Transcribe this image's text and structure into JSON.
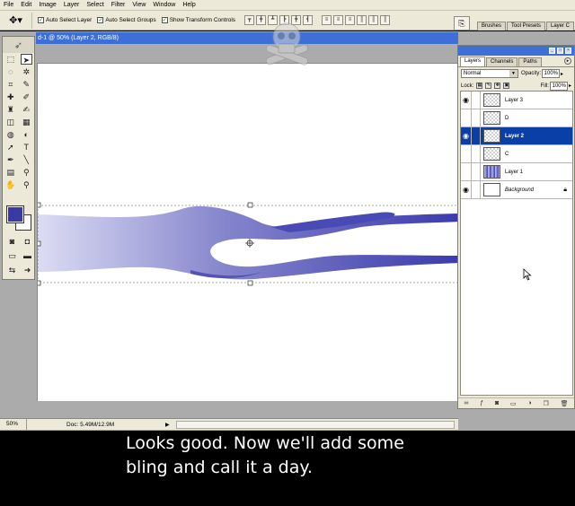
{
  "menu": [
    "File",
    "Edit",
    "Image",
    "Layer",
    "Select",
    "Filter",
    "View",
    "Window",
    "Help"
  ],
  "options": {
    "auto_select_layer": "Auto Select Layer",
    "auto_select_groups": "Auto Select Groups",
    "show_transform_controls": "Show Transform Controls"
  },
  "dock_tabs": [
    "Brushes",
    "Tool Presets",
    "Layer C"
  ],
  "document": {
    "title": "d-1 @ 50% (Layer 2, RGB/8)",
    "zoom": "50%",
    "doc_size": "Doc: 5.49M/12.9M"
  },
  "layers_panel": {
    "tabs": [
      "Layers",
      "Channels",
      "Paths"
    ],
    "blend_mode": "Normal",
    "opacity_label": "Opacity:",
    "opacity": "100%",
    "lock_label": "Lock:",
    "fill_label": "Fill:",
    "fill": "100%",
    "layers": [
      {
        "name": "Layer 3",
        "visible": true,
        "thumb": "checker",
        "selected": false
      },
      {
        "name": "D",
        "visible": false,
        "thumb": "checker",
        "selected": false
      },
      {
        "name": "Layer 2",
        "visible": true,
        "thumb": "checker",
        "selected": true
      },
      {
        "name": "C",
        "visible": false,
        "thumb": "checker",
        "selected": false
      },
      {
        "name": "Layer 1",
        "visible": false,
        "thumb": "gradient",
        "selected": false
      },
      {
        "name": "Background",
        "visible": true,
        "thumb": "white",
        "selected": false
      }
    ]
  },
  "caption": {
    "line1": "Looks good.  Now we'll add some",
    "line2": "bling and call it a day."
  },
  "colors": {
    "foreground": "#3a3aa6",
    "flame_dark": "#3b3bad",
    "flame_light": "#dcdcf4",
    "selection_bar": "#0b3fa8",
    "title_bar": "#3d6fd6"
  }
}
